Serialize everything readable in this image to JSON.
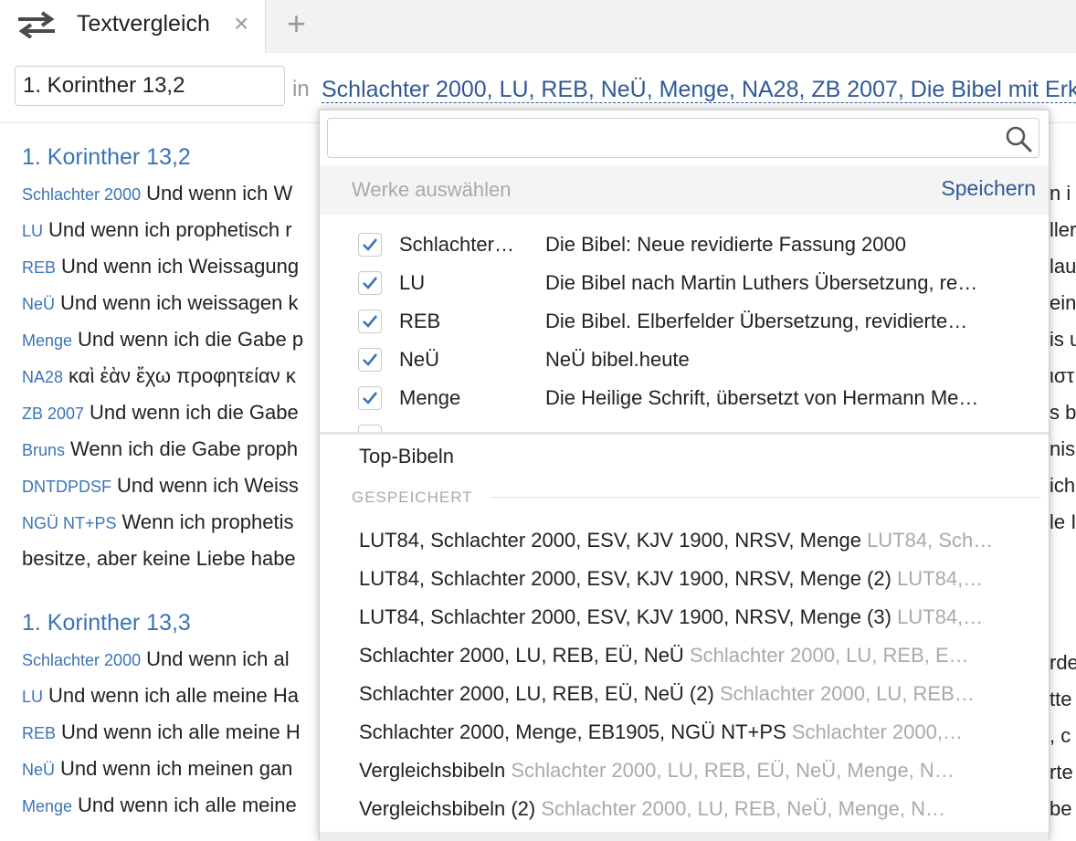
{
  "tab": {
    "title": "Textvergleich",
    "close": "×",
    "add": "+"
  },
  "toolbar": {
    "reference": "1. Korinther 13,2",
    "in": "in",
    "works": "Schlachter 2000, LU, REB, NeÜ, Menge, NA28, ZB 2007, Die Bibel mit Erk"
  },
  "sections": [
    {
      "title": "1. Korinther 13,2",
      "verses": [
        {
          "abbr": "Schlachter 2000",
          "text": "Und wenn ich W"
        },
        {
          "abbr": "LU",
          "text": "Und wenn ich prophetisch r"
        },
        {
          "abbr": "REB",
          "text": "Und wenn ich Weissagung"
        },
        {
          "abbr": "NeÜ",
          "text": "Und wenn ich weissagen k"
        },
        {
          "abbr": "Menge",
          "text": "Und wenn ich die Gabe p"
        },
        {
          "abbr": "NA28",
          "text": "καὶ ἐὰν ἔχω προφητείαν κ"
        },
        {
          "abbr": "ZB 2007",
          "text": "Und wenn ich die Gabe"
        },
        {
          "abbr": "Bruns",
          "text": "Wenn ich die Gabe proph"
        },
        {
          "abbr": "DNTDPDSF",
          "text": "Und wenn ich Weiss"
        },
        {
          "abbr": "NGÜ NT+PS",
          "text": "Wenn ich prophetis"
        }
      ],
      "continuation": "besitze, aber keine Liebe habe"
    },
    {
      "title": "1. Korinther 13,3",
      "verses": [
        {
          "abbr": "Schlachter 2000",
          "text": "Und wenn ich al"
        },
        {
          "abbr": "LU",
          "text": "Und wenn ich alle meine Ha"
        },
        {
          "abbr": "REB",
          "text": "Und wenn ich alle meine H"
        },
        {
          "abbr": "NeÜ",
          "text": "Und wenn ich meinen gan"
        },
        {
          "abbr": "Menge",
          "text": "Und wenn ich alle meine"
        }
      ]
    }
  ],
  "right_fragments": [
    "n i",
    "ller",
    "lau",
    "ein",
    "is u",
    "ιστ",
    "s be",
    "niss",
    "ich",
    "le I",
    "",
    "",
    "rde",
    "tte",
    ", c",
    "rte",
    "be"
  ],
  "popup": {
    "search_placeholder": "",
    "select_title": "Werke auswählen",
    "save": "Speichern",
    "works": [
      {
        "abbr": "Schlachter…",
        "name": "Die Bibel: Neue revidierte Fassung 2000"
      },
      {
        "abbr": "LU",
        "name": "Die Bibel nach Martin Luthers Übersetzung, re…"
      },
      {
        "abbr": "REB",
        "name": "Die Bibel. Elberfelder Übersetzung, revidierte…"
      },
      {
        "abbr": "NeÜ",
        "name": "NeÜ bibel.heute"
      },
      {
        "abbr": "Menge",
        "name": "Die Heilige Schrift, übersetzt von Hermann Me…"
      }
    ],
    "top_bibles": "Top-Bibeln",
    "saved_label": "GESPEICHERT",
    "saved": [
      {
        "name": "LUT84, Schlachter 2000, ESV, KJV 1900, NRSV, Menge",
        "detail": "LUT84, Sch…"
      },
      {
        "name": "LUT84, Schlachter 2000, ESV, KJV 1900, NRSV, Menge (2)",
        "detail": "LUT84,…"
      },
      {
        "name": "LUT84, Schlachter 2000, ESV, KJV 1900, NRSV, Menge (3)",
        "detail": "LUT84,…"
      },
      {
        "name": "Schlachter 2000, LU, REB, EÜ, NeÜ",
        "detail": "Schlachter 2000, LU, REB, E…"
      },
      {
        "name": "Schlachter 2000, LU, REB, EÜ, NeÜ (2)",
        "detail": "Schlachter 2000, LU, REB…"
      },
      {
        "name": "Schlachter 2000, Menge, EB1905, NGÜ NT+PS",
        "detail": "Schlachter 2000,…"
      },
      {
        "name": "Vergleichsbibeln",
        "detail": "Schlachter 2000, LU, REB, EÜ, NeÜ, Menge, N…"
      },
      {
        "name": "Vergleichsbibeln (2)",
        "detail": "Schlachter 2000, LU, REB, NeÜ, Menge, N…"
      }
    ]
  },
  "colors": {
    "link": "#2f5a96",
    "abbr": "#3b74b5",
    "check": "#3b74b5",
    "muted": "#aaaaaa"
  }
}
